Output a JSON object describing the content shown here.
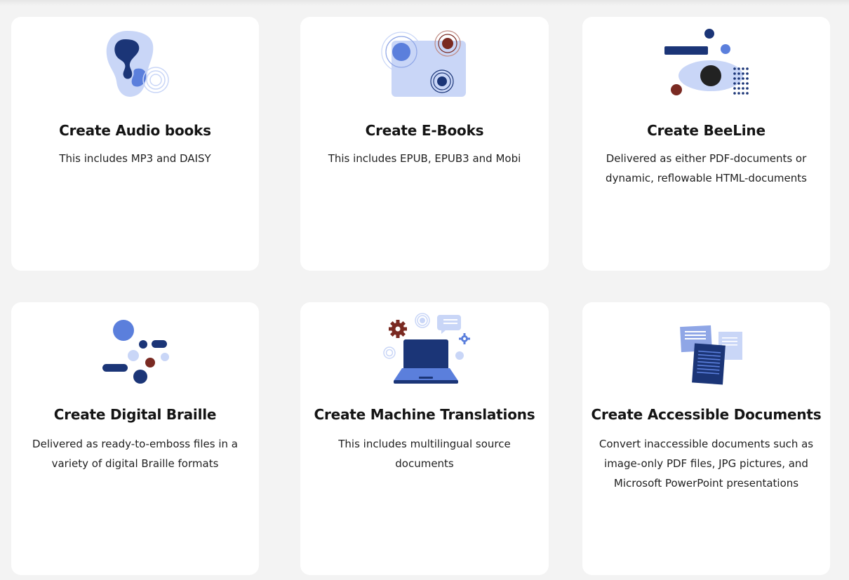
{
  "palette": {
    "navy": "#1b3577",
    "blue": "#5b7fdc",
    "light_blue": "#c9d6f7",
    "maroon": "#7a2a22",
    "dark": "#222222",
    "page_bg": "#f3f3f3",
    "card_bg": "#ffffff"
  },
  "cards": [
    {
      "icon": "ear-sound-icon",
      "title": "Create Audio books",
      "description": "This includes MP3 and DAISY"
    },
    {
      "icon": "ebook-circles-icon",
      "title": "Create E-Books",
      "description": "This includes EPUB, EPUB3 and Mobi"
    },
    {
      "icon": "beeline-eye-icon",
      "title": "Create BeeLine",
      "description": "Delivered as either PDF-documents or dynamic, reflowable HTML-documents"
    },
    {
      "icon": "braille-dots-icon",
      "title": "Create Digital Braille",
      "description": "Delivered as ready-to-emboss files in a variety of digital Braille formats"
    },
    {
      "icon": "laptop-translation-icon",
      "title": "Create Machine Translations",
      "description": "This includes multilingual source documents"
    },
    {
      "icon": "documents-stack-icon",
      "title": "Create Accessible Documents",
      "description": "Convert inaccessible documents such as image-only PDF files, JPG pictures, and Microsoft PowerPoint presentations"
    }
  ]
}
